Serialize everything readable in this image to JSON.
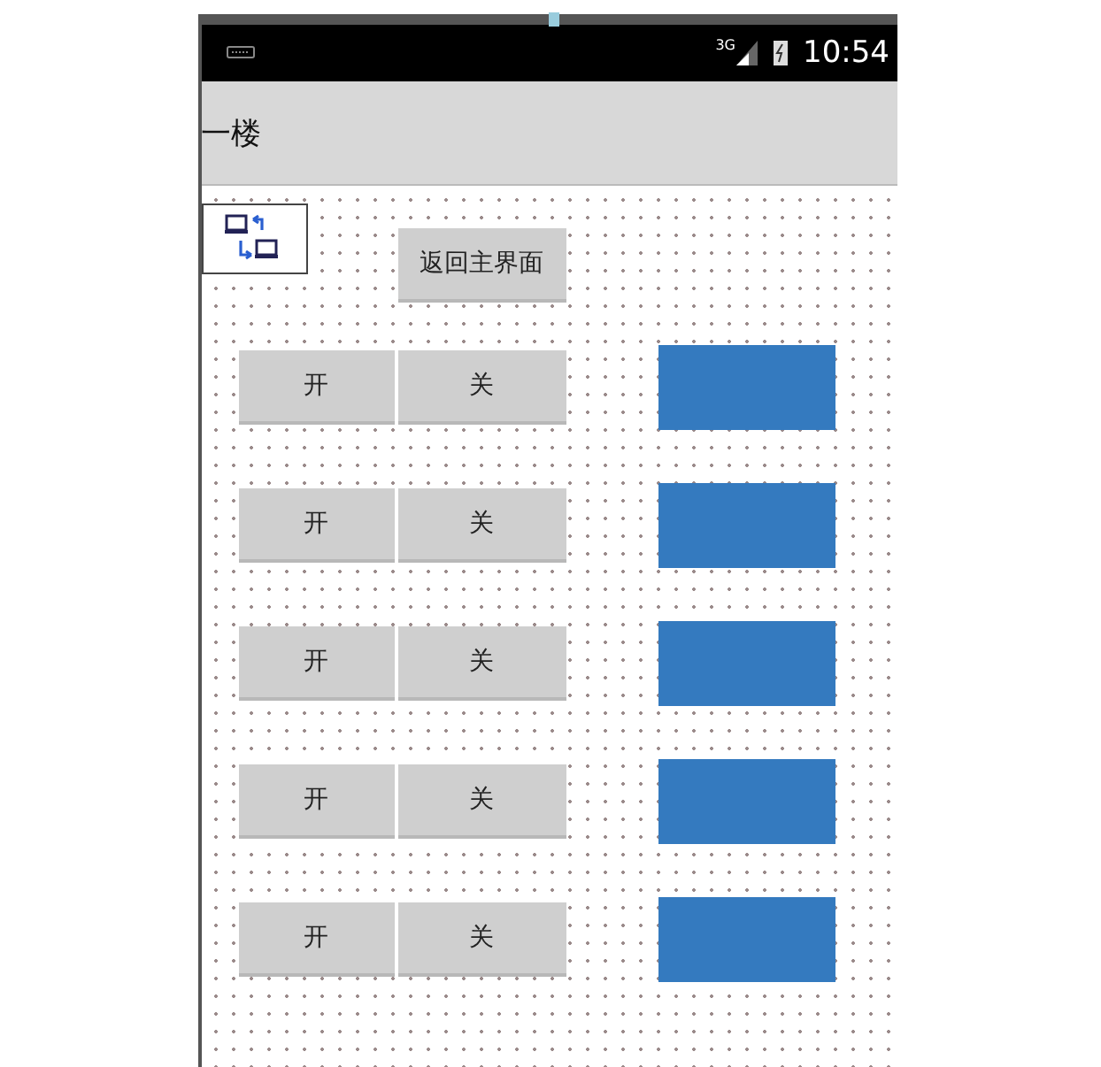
{
  "status_bar": {
    "network_type": "3G",
    "time": "10:54"
  },
  "title_bar": {
    "title": "一楼"
  },
  "back_button": {
    "label": "返回主界面"
  },
  "rows": [
    {
      "on_label": "开",
      "off_label": "关"
    },
    {
      "on_label": "开",
      "off_label": "关"
    },
    {
      "on_label": "开",
      "off_label": "关"
    },
    {
      "on_label": "开",
      "off_label": "关"
    },
    {
      "on_label": "开",
      "off_label": "关"
    }
  ]
}
